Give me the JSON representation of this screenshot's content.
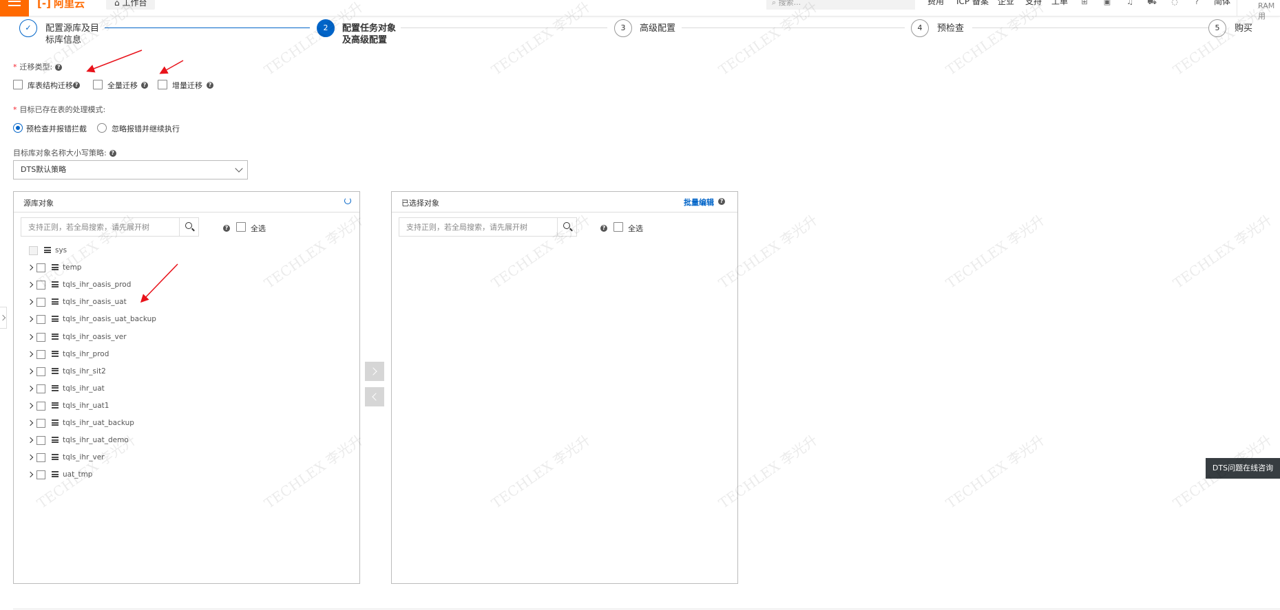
{
  "topbar": {
    "logo": "阿里云",
    "workbench": "工作台",
    "search_placeholder": "搜索...",
    "links": [
      "费用",
      "ICP 备案",
      "企业",
      "支持",
      "工单"
    ],
    "lang": "简体",
    "account": "RAM 用",
    "icons": [
      "app-icon",
      "image-icon",
      "bell-icon",
      "cart-icon",
      "bulb-icon",
      "help-icon"
    ]
  },
  "steps": [
    {
      "num": "✓",
      "label_line1": "配置源库及目",
      "label_line2": "标库信息",
      "state": "done"
    },
    {
      "num": "2",
      "label_line1": "配置任务对象",
      "label_line2": "及高级配置",
      "state": "active"
    },
    {
      "num": "3",
      "label_line1": "高级配置",
      "label_line2": "",
      "state": "pending"
    },
    {
      "num": "4",
      "label_line1": "预检查",
      "label_line2": "",
      "state": "pending"
    },
    {
      "num": "5",
      "label_line1": "购买",
      "label_line2": "",
      "state": "pending"
    }
  ],
  "migration_type": {
    "label": "迁移类型:",
    "options": [
      {
        "label": "库表结构迁移",
        "checked": false
      },
      {
        "label": "全量迁移",
        "checked": false
      },
      {
        "label": "增量迁移",
        "checked": false
      }
    ]
  },
  "existing_table_mode": {
    "label": "目标已存在表的处理模式:",
    "options": [
      {
        "label": "预检查并报错拦截",
        "selected": true
      },
      {
        "label": "忽略报错并继续执行",
        "selected": false
      }
    ]
  },
  "case_strategy": {
    "label": "目标库对象名称大小写策略:",
    "value": "DTS默认策略"
  },
  "source_panel": {
    "title": "源库对象",
    "search_placeholder": "支持正则，若全局搜索，请先展开树",
    "select_all": "全选",
    "databases": [
      {
        "name": "sys",
        "expandable": false,
        "disabled": true
      },
      {
        "name": "temp",
        "expandable": true,
        "disabled": false
      },
      {
        "name": "tqls_ihr_oasis_prod",
        "expandable": true,
        "disabled": false
      },
      {
        "name": "tqls_ihr_oasis_uat",
        "expandable": true,
        "disabled": false
      },
      {
        "name": "tqls_ihr_oasis_uat_backup",
        "expandable": true,
        "disabled": false
      },
      {
        "name": "tqls_ihr_oasis_ver",
        "expandable": true,
        "disabled": false
      },
      {
        "name": "tqls_ihr_prod",
        "expandable": true,
        "disabled": false
      },
      {
        "name": "tqls_ihr_sit2",
        "expandable": true,
        "disabled": false
      },
      {
        "name": "tqls_ihr_uat",
        "expandable": true,
        "disabled": false
      },
      {
        "name": "tqls_ihr_uat1",
        "expandable": true,
        "disabled": false
      },
      {
        "name": "tqls_ihr_uat_backup",
        "expandable": true,
        "disabled": false
      },
      {
        "name": "tqls_ihr_uat_demo",
        "expandable": true,
        "disabled": false
      },
      {
        "name": "tqls_ihr_ver",
        "expandable": true,
        "disabled": false
      },
      {
        "name": "uat_tmp",
        "expandable": true,
        "disabled": false
      }
    ]
  },
  "selected_panel": {
    "title": "已选择对象",
    "bulk_edit": "批量编辑",
    "search_placeholder": "支持正则，若全局搜索，请先展开树",
    "select_all": "全选"
  },
  "consult_button": "DTS问题在线咨询",
  "watermark": {
    "text_cn": "李光升",
    "text_en": "TECHLEX"
  },
  "colors": {
    "primary": "#0064c8",
    "brand": "#ff6a00",
    "annotation": "#e8131b"
  }
}
